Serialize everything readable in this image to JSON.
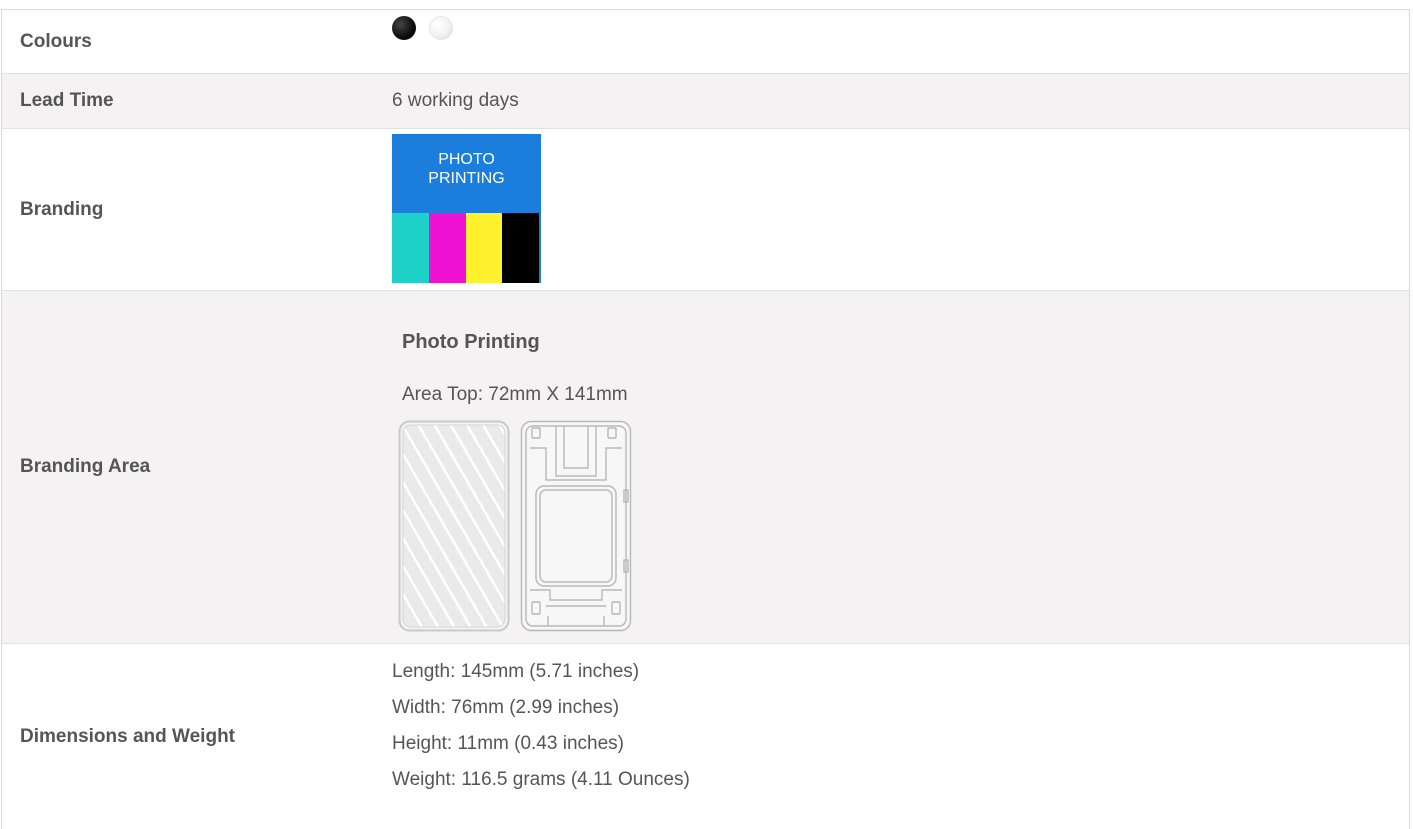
{
  "specs": {
    "colours": {
      "label": "Colours",
      "swatches": [
        {
          "name": "black",
          "color": "#000000"
        },
        {
          "name": "white",
          "color": "#ffffff"
        }
      ]
    },
    "lead_time": {
      "label": "Lead Time",
      "value": "6 working days"
    },
    "branding": {
      "label": "Branding",
      "badge_line1": "PHOTO",
      "badge_line2": "PRINTING",
      "badge_color": "#1b7ddc",
      "cmyk_colors": [
        "#1dd0c8",
        "#f012d2",
        "#fff12e",
        "#000000"
      ]
    },
    "branding_area": {
      "label": "Branding Area",
      "method": "Photo Printing",
      "area": "Area Top: 72mm X 141mm"
    },
    "dimensions": {
      "label": "Dimensions and Weight",
      "length": "Length: 145mm (5.71 inches)",
      "width": "Width: 76mm (2.99 inches)",
      "height": "Height: 11mm (0.43 inches)",
      "weight": "Weight: 116.5 grams (4.11 Ounces)"
    }
  }
}
